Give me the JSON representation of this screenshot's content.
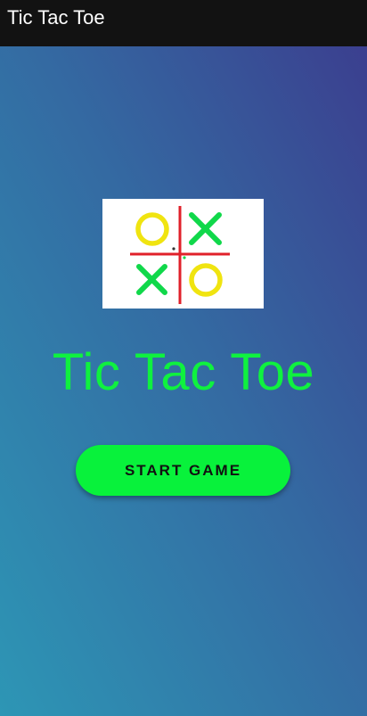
{
  "app_bar": {
    "title": "Tic Tac Toe"
  },
  "main": {
    "logo": {
      "icon": "tic-tac-toe-board-icon",
      "colors": {
        "grid": "#e0202a",
        "o": "#f0e410",
        "x": "#10d84a",
        "background": "#ffffff"
      }
    },
    "headline": "Tic Tac Toe",
    "start_button_label": "START GAME"
  },
  "colors": {
    "app_bar": "#121212",
    "gradient_start": "#2d96b5",
    "gradient_end": "#3b3f8f",
    "accent_green": "#0ff13f",
    "button_green": "#08f23b"
  }
}
